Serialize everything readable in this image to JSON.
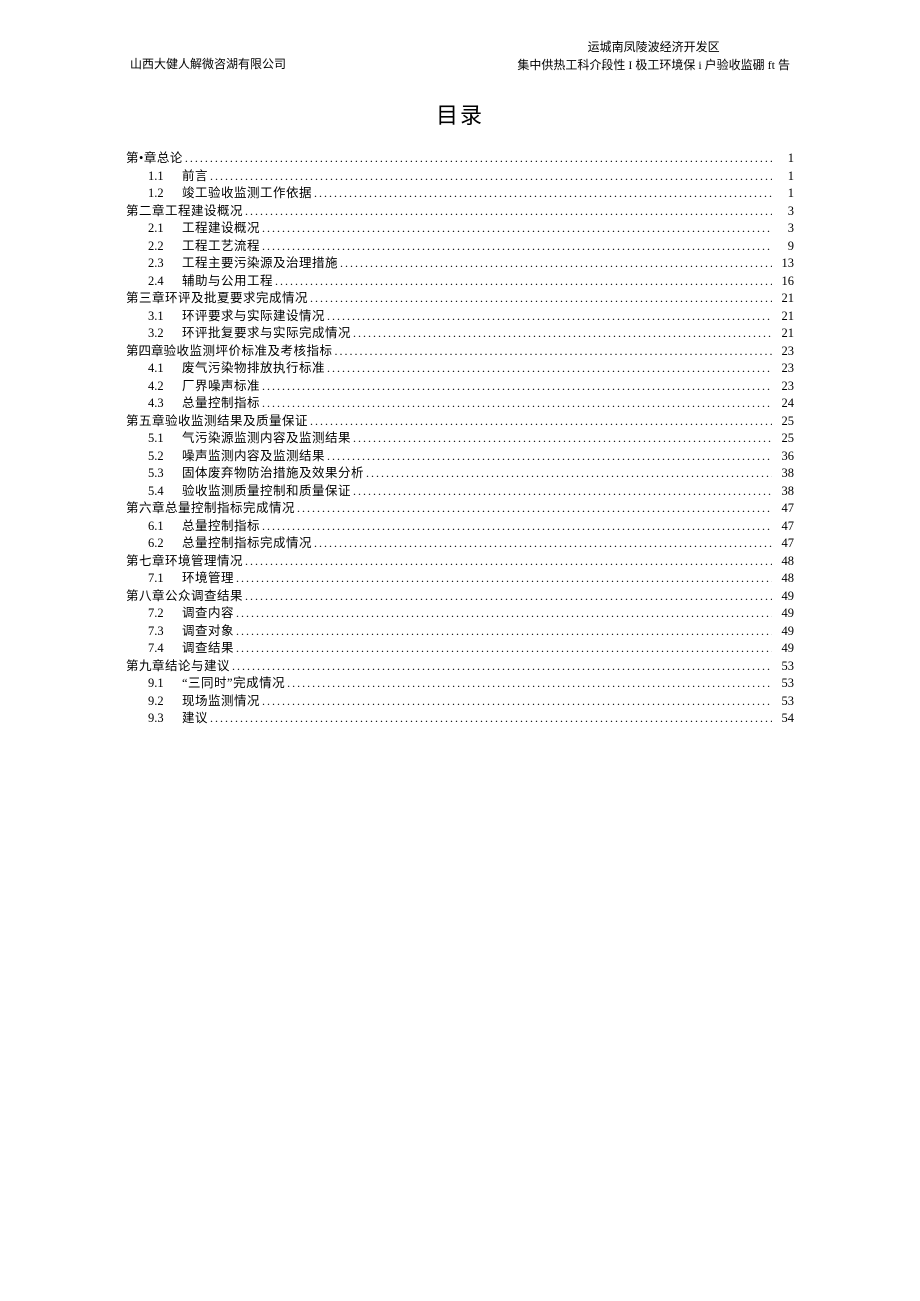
{
  "header": {
    "left": "山西大健人解微咨湖有限公司",
    "right_line1": "运城南凤陵波经济开发区",
    "right_line2": "集中供热工科介段性 I 极工环境保 i 户验收监硼 ft 告"
  },
  "title": "目录",
  "toc": [
    {
      "level": 1,
      "num": "",
      "label": "第•章总论",
      "page": "1"
    },
    {
      "level": 2,
      "num": "1.1",
      "label": "前言",
      "page": "1"
    },
    {
      "level": 2,
      "num": "1.2",
      "label": "竣工验收监测工作依据",
      "page": "1"
    },
    {
      "level": 1,
      "num": "",
      "label": "第二章工程建设概况",
      "page": "3"
    },
    {
      "level": 2,
      "num": "2.1",
      "label": "工程建设概况",
      "page": "3"
    },
    {
      "level": 2,
      "num": "2.2",
      "label": "工程工艺流程",
      "page": "9"
    },
    {
      "level": 2,
      "num": "2.3",
      "label": "工程主要污染源及治理措施",
      "page": "13"
    },
    {
      "level": 2,
      "num": "2.4",
      "label": "辅助与公用工程",
      "page": "16"
    },
    {
      "level": 1,
      "num": "",
      "label": "第三章环评及批夏要求完成情况",
      "page": "21"
    },
    {
      "level": 2,
      "num": "3.1",
      "label": "环评要求与实际建设情况",
      "page": "21"
    },
    {
      "level": 2,
      "num": "3.2",
      "label": "环评批复要求与实际完成情况",
      "page": "21"
    },
    {
      "level": 1,
      "num": "第四章",
      "label": "验收监测坪价标准及考核指标",
      "page": "23"
    },
    {
      "level": 2,
      "num": "4.1",
      "label": "废气污染物排放执行标准",
      "page": "23"
    },
    {
      "level": 2,
      "num": "4.2",
      "label": "厂界噪声标准",
      "page": "23"
    },
    {
      "level": 2,
      "num": "4.3",
      "label": "总量控制指标",
      "page": "24"
    },
    {
      "level": 1,
      "num": "",
      "label": "第五章验收监测结果及质量保证",
      "page": "25"
    },
    {
      "level": 2,
      "num": "5.1",
      "label": "气污染源监测内容及监测结果",
      "page": "25"
    },
    {
      "level": 2,
      "num": "5.2",
      "label": "噪声监测内容及监测结果",
      "page": "36"
    },
    {
      "level": 2,
      "num": "5.3",
      "label": "固体废弃物防治措施及效果分析",
      "page": "38"
    },
    {
      "level": 2,
      "num": "5.4",
      "label": "验收监测质量控制和质量保证",
      "page": "38"
    },
    {
      "level": 1,
      "num": "",
      "label": "第六章总量控制指标完成情况",
      "page": "47"
    },
    {
      "level": 2,
      "num": "6.1",
      "label": "总量控制指标",
      "page": "47"
    },
    {
      "level": 2,
      "num": "6.2",
      "label": "总量控制指标完成情况",
      "page": "47"
    },
    {
      "level": 1,
      "num": "",
      "label": "第七章环境管理情况",
      "page": "48"
    },
    {
      "level": 2,
      "num": "7.1",
      "label": "环境管理",
      "page": "48"
    },
    {
      "level": 1,
      "num": "",
      "label": "第八章公众调查结果",
      "page": "49"
    },
    {
      "level": 2,
      "num": "7.2",
      "label": "调查内容",
      "page": "49"
    },
    {
      "level": 2,
      "num": "7.3",
      "label": "调查对象",
      "page": "49"
    },
    {
      "level": 2,
      "num": "7.4",
      "label": "调查结果",
      "page": "49"
    },
    {
      "level": 1,
      "num": "",
      "label": "第九章结论与建议",
      "page": "53"
    },
    {
      "level": 2,
      "num": "9.1",
      "label": "“三同时”完成情况",
      "page": "53"
    },
    {
      "level": 2,
      "num": "9.2",
      "label": "现场监测情况",
      "page": "53"
    },
    {
      "level": 2,
      "num": "9.3",
      "label": "建议",
      "page": "54"
    }
  ]
}
